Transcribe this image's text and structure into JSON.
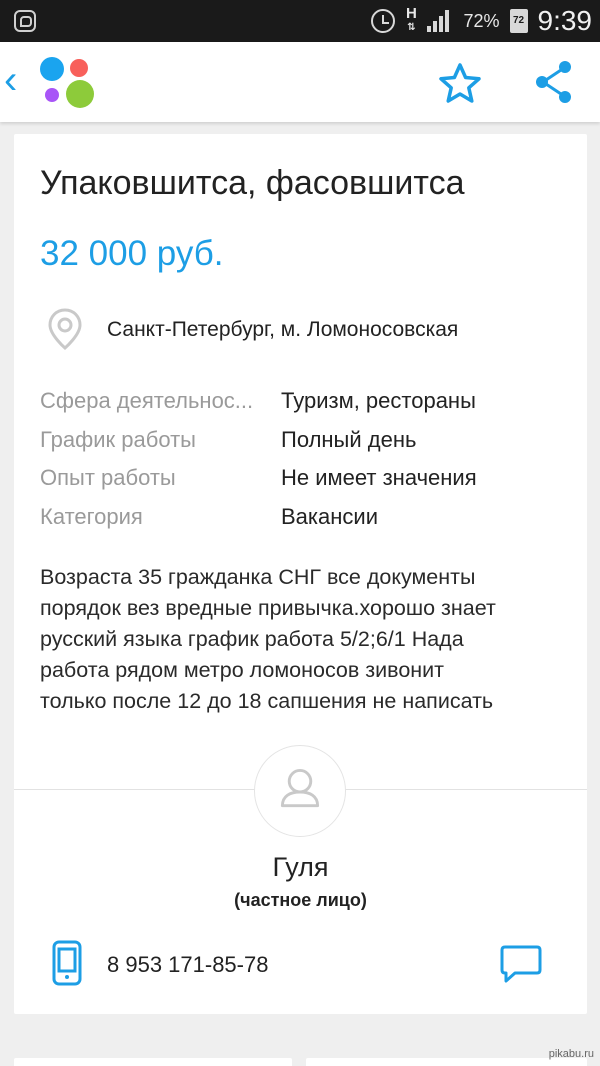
{
  "status_bar": {
    "network": "H",
    "battery_percent": "72%",
    "battery_level": "72",
    "time": "9:39"
  },
  "app_bar": {
    "icons": [
      "back-icon",
      "app-logo",
      "star-icon",
      "share-icon"
    ],
    "colors": {
      "accent": "#1d9ee5",
      "logo_blue": "#1aa4ef",
      "logo_red": "#f8605b",
      "logo_purple": "#a855f7",
      "logo_green": "#8dcb3a"
    }
  },
  "listing": {
    "title": "Упаковшитса, фасовшитса",
    "price": "32 000 руб.",
    "location": "Санкт-Петербург, м. Ломоносовская",
    "params": [
      {
        "key": "Сфера деятельнос...",
        "value": "Туризм, рестораны"
      },
      {
        "key": "График работы",
        "value": "Полный день"
      },
      {
        "key": "Опыт работы",
        "value": "Не имеет значения"
      },
      {
        "key": "Категория",
        "value": "Вакансии"
      }
    ],
    "description_lines": [
      "Возраста 35 гражданка СНГ все документы",
      "порядок вез вредные привычка.хорошо знает",
      "русский языка график работа 5/2;6/1 Нада",
      "работа рядом метро ломоносов зивонит",
      "только после 12 до 18 сапшения не написать"
    ]
  },
  "seller": {
    "name": "Гуля",
    "type": "(частное лицо)",
    "phone": "8 953 171-85-78"
  },
  "watermark": "pikabu.ru"
}
